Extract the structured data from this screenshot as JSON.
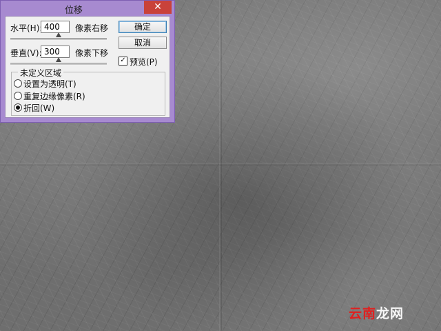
{
  "dialog": {
    "title": "位移",
    "close_glyph": "✕",
    "horizontal": {
      "label": "水平(H):",
      "value": "400",
      "unit_label": "像素右移",
      "slider_fraction": 0.5
    },
    "vertical": {
      "label": "垂直(V):",
      "value": "300",
      "unit_label": "像素下移",
      "slider_fraction": 0.5
    },
    "buttons": {
      "ok": "确定",
      "cancel": "取消"
    },
    "preview": {
      "label": "预览(P)",
      "checked": true,
      "check_glyph": "✓"
    },
    "undefined_area": {
      "title": "未定义区域",
      "options": [
        {
          "label": "设置为透明(T)",
          "selected": false
        },
        {
          "label": "重复边缘像素(R)",
          "selected": false
        },
        {
          "label": "折回(W)",
          "selected": true
        }
      ]
    }
  },
  "watermark": {
    "part1": "云南",
    "part2": "龙网"
  },
  "colors": {
    "titlebar": "#a78ad0",
    "close_button": "#c9423a",
    "dialog_body": "#f0f0f0",
    "default_button_border": "#3c7fb1"
  }
}
